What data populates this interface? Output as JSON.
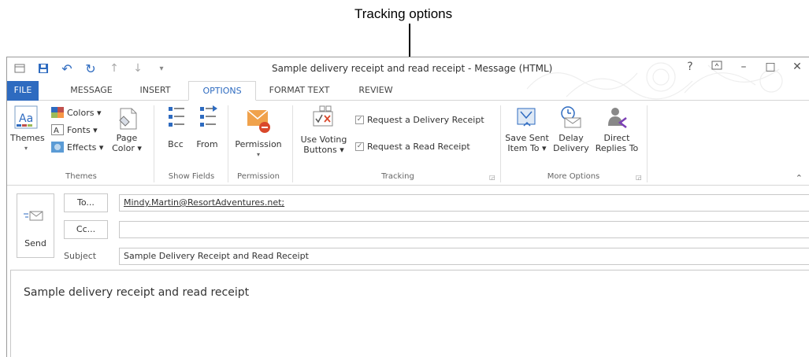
{
  "callout": {
    "text": "Tracking options"
  },
  "window": {
    "title": "Sample delivery receipt and read receipt - Message (HTML)",
    "help": "?",
    "minimize": "–",
    "maximize": "□",
    "close": "✕"
  },
  "tabs": {
    "file": "FILE",
    "message": "MESSAGE",
    "insert": "INSERT",
    "options": "OPTIONS",
    "format_text": "FORMAT TEXT",
    "review": "REVIEW"
  },
  "ribbon": {
    "themes_group": {
      "label": "Themes",
      "themes_btn": "Themes",
      "colors": "Colors ▾",
      "fonts": "Fonts ▾",
      "effects": "Effects ▾",
      "page_color_line1": "Page",
      "page_color_line2": "Color ▾"
    },
    "show_fields_group": {
      "label": "Show Fields",
      "bcc": "Bcc",
      "from": "From"
    },
    "permission_group": {
      "label": "Permission",
      "permission_btn": "Permission"
    },
    "tracking_group": {
      "label": "Tracking",
      "voting_line1": "Use Voting",
      "voting_line2": "Buttons ▾",
      "delivery_receipt": "Request a Delivery Receipt",
      "read_receipt": "Request a Read Receipt"
    },
    "more_options_group": {
      "label": "More Options",
      "save_sent_line1": "Save Sent",
      "save_sent_line2": "Item To ▾",
      "delay_line1": "Delay",
      "delay_line2": "Delivery",
      "direct_line1": "Direct",
      "direct_line2": "Replies To"
    }
  },
  "compose": {
    "send": "Send",
    "to_btn": "To...",
    "cc_btn": "Cc...",
    "to_value": "Mindy.Martin@ResortAdventures.net;",
    "cc_value": "",
    "subject_label": "Subject",
    "subject_value": "Sample Delivery Receipt and Read Receipt",
    "body": "Sample delivery receipt and read receipt"
  },
  "colors": {
    "accent": "#2e6bc0",
    "permission_icon": "#f0a24c"
  }
}
